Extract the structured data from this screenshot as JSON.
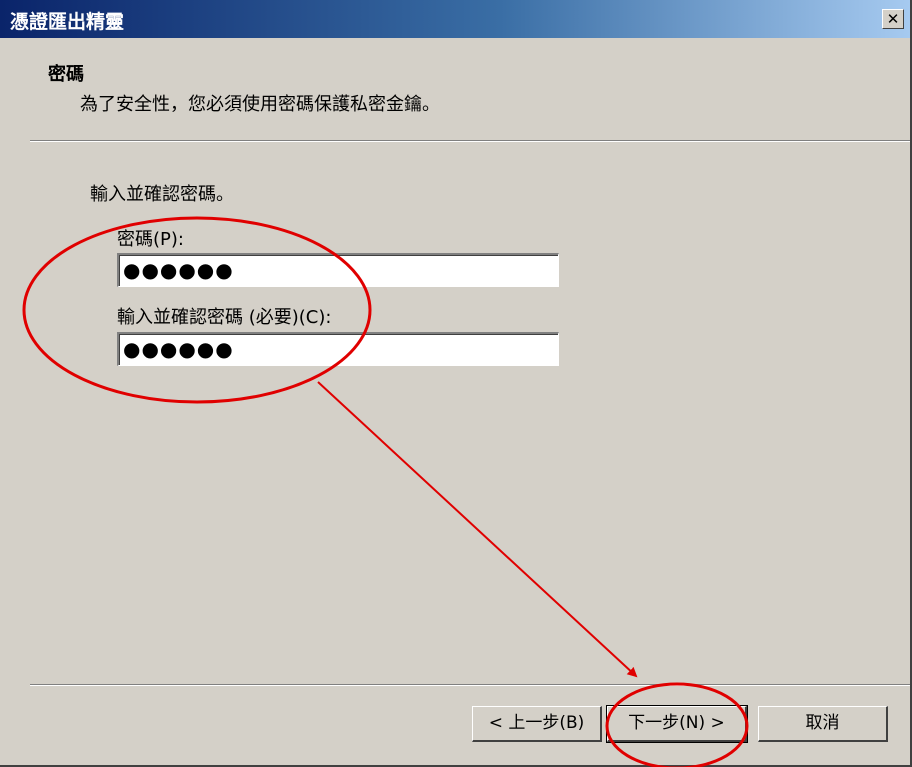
{
  "window": {
    "title": "憑證匯出精靈",
    "close_label": "✕"
  },
  "header": {
    "title": "密碼",
    "subtitle": "為了安全性，您必須使用密碼保護私密金鑰。"
  },
  "body": {
    "instruction": "輸入並確認密碼。",
    "password_label": "密碼(P):",
    "password_value": "●●●●●●",
    "confirm_label": "輸入並確認密碼 (必要)(C):",
    "confirm_value": "●●●●●●"
  },
  "buttons": {
    "back": "< 上一步(B)",
    "next": "下一步(N) >",
    "cancel": "取消"
  },
  "colors": {
    "dialog_bg": "#d4d0c8",
    "title_gradient_start": "#0a246a",
    "title_gradient_end": "#a6caf0",
    "annotation": "#e00000"
  }
}
